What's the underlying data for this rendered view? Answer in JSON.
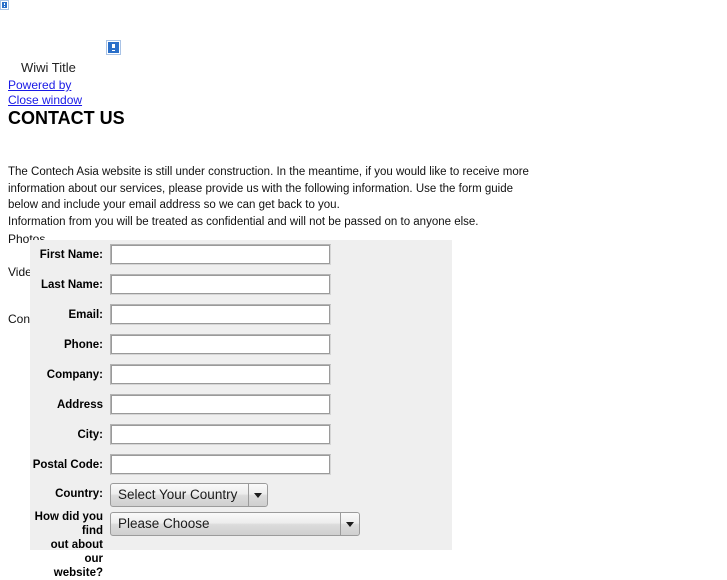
{
  "header": {
    "site_title": "Wiwi Title",
    "powered_by_link": "Powered by",
    "close_window_link": "Close window",
    "page_title": "CONTACT US",
    "corner_image_alt": "broken-image",
    "logo_image_alt": "broken-image"
  },
  "intro": {
    "paragraph_1": "The Contech Asia website is still under construction.  In the meantime, if you would like to receive more information about our services, please provide us with the following information. Use the form guide below and include your email address so we can get back to you.",
    "paragraph_2": "Information from you will be treated as confidential and will not be passed on to anyone else."
  },
  "background_column": {
    "item_1": "Photos",
    "item_2": "Video",
    "item_3": "Contact"
  },
  "form": {
    "fields": [
      {
        "label": "First Name:",
        "value": "",
        "type": "text"
      },
      {
        "label": "Last Name:",
        "value": "",
        "type": "text"
      },
      {
        "label": "Email:",
        "value": "",
        "type": "text"
      },
      {
        "label": "Phone:",
        "value": "",
        "type": "text"
      },
      {
        "label": "Company:",
        "value": "",
        "type": "text"
      },
      {
        "label": "Address",
        "value": "",
        "type": "text"
      },
      {
        "label": "City:",
        "value": "",
        "type": "text"
      },
      {
        "label": "Postal Code:",
        "value": "",
        "type": "text"
      }
    ],
    "country": {
      "label": "Country:",
      "selected": "Select Your Country"
    },
    "referral": {
      "label": "How did you find out about our website?",
      "label_line_1": "How did you find",
      "label_line_2": "out about our",
      "label_line_3": "website?",
      "selected": "Please Choose"
    }
  },
  "colors": {
    "panel_background": "#efefef",
    "link": "#1a1ae6",
    "page_background": "#ffffff",
    "input_background": "#ffffff"
  }
}
